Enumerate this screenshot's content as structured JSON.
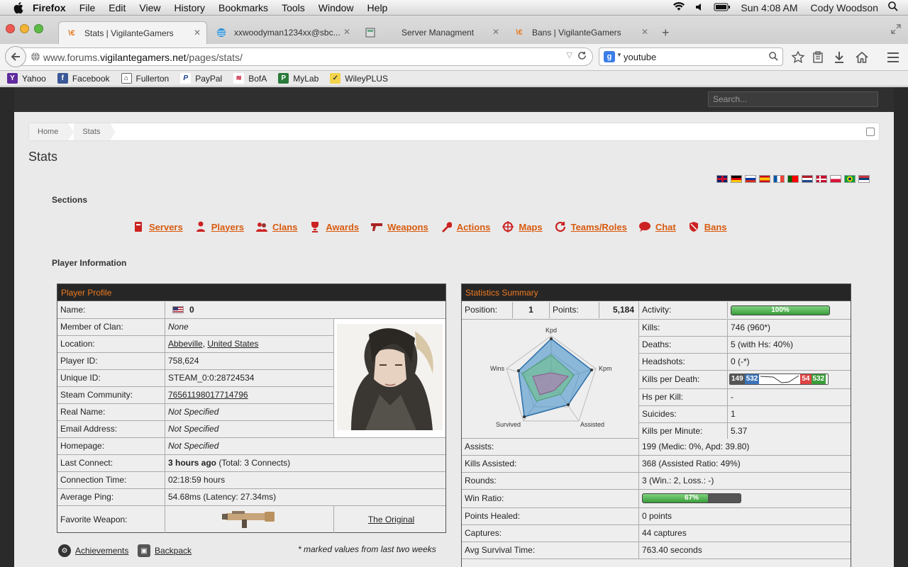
{
  "menubar": {
    "app": "Firefox",
    "items": [
      "File",
      "Edit",
      "View",
      "History",
      "Bookmarks",
      "Tools",
      "Window",
      "Help"
    ],
    "clock": "Sun 4:08 AM",
    "user": "Cody Woodson"
  },
  "tabs": [
    {
      "label": "Stats | VigilanteGamers",
      "icon": "vg-icon"
    },
    {
      "label": "xxwoodyman1234xx@sbc...",
      "icon": "att-icon"
    },
    {
      "label": "Server Managment",
      "icon": "server-icon"
    },
    {
      "label": "Bans | VigilanteGamers",
      "icon": "vg-icon"
    }
  ],
  "tab_close": "✕",
  "new_tab": "+",
  "nav": {
    "url_prefix": "www.forums.",
    "url_domain": "vigilantegamers.net",
    "url_path": "/pages/stats/",
    "search_value": "youtube"
  },
  "bookmarks": [
    "Yahoo",
    "Facebook",
    "Fullerton",
    "PayPal",
    "BofA",
    "MyLab",
    "WileyPLUS"
  ],
  "site": {
    "search_placeholder": "Search...",
    "breadcrumb": [
      "Home",
      "Stats"
    ],
    "page_title": "Stats",
    "sections_title": "Sections",
    "sections": [
      "Servers",
      "Players",
      "Clans",
      "Awards",
      "Weapons",
      "Actions",
      "Maps",
      "Teams/Roles",
      "Chat",
      "Bans"
    ],
    "player_info_title": "Player Information"
  },
  "profile": {
    "header": "Player Profile",
    "rows": [
      {
        "label": "Name:",
        "value": "0"
      },
      {
        "label": "Member of Clan:",
        "value": "None"
      },
      {
        "label": "Location:",
        "value": "Abbeville",
        "value2": "United States"
      },
      {
        "label": "Player ID:",
        "value": "758,624"
      },
      {
        "label": "Unique ID:",
        "value": "STEAM_0:0:28724534"
      },
      {
        "label": "Steam Community:",
        "value": "76561198017714796"
      },
      {
        "label": "Real Name:",
        "value": "Not Specified"
      },
      {
        "label": "Email Address:",
        "value": "Not Specified"
      },
      {
        "label": "Homepage:",
        "value": "Not Specified"
      },
      {
        "label": "Last Connect:",
        "value": "3 hours ago",
        "value2": "(Total: 3 Connects)"
      },
      {
        "label": "Connection Time:",
        "value": "02:18:59 hours"
      },
      {
        "label": "Average Ping:",
        "value": "54.68ms (Latency: 27.34ms)"
      },
      {
        "label": "Favorite Weapon:",
        "value": "The Original"
      }
    ],
    "achievements": "Achievements",
    "backpack": "Backpack",
    "footnote": "* marked values from last two weeks"
  },
  "summary": {
    "header": "Statistics Summary",
    "position_label": "Position:",
    "position": "1",
    "points_label": "Points:",
    "points": "5,184",
    "activity_label": "Activity:",
    "activity": "100%",
    "activity_frac": 1.0,
    "radar_labels": [
      "Kpd",
      "Kpm",
      "Assisted",
      "Survived",
      "Wins"
    ],
    "right_rows": [
      {
        "label": "Kills:",
        "value": "746 (960*)"
      },
      {
        "label": "Deaths:",
        "value": "5 (with Hs: 40%)"
      },
      {
        "label": "Headshots:",
        "value": "0 (-*)"
      },
      {
        "label": "Kills per Death:",
        "value": ""
      },
      {
        "label": "Hs per Kill:",
        "value": "-"
      },
      {
        "label": "Suicides:",
        "value": "1"
      },
      {
        "label": "Kills per Minute:",
        "value": "5.37"
      }
    ],
    "kpd_badges": [
      "149",
      "532",
      "54",
      "532"
    ],
    "full_rows": [
      {
        "label": "Assists:",
        "value": "199 (Medic: 0%, Apd: 39.80)"
      },
      {
        "label": "Kills Assisted:",
        "value": "368 (Assisted Ratio: 49%)"
      },
      {
        "label": "Rounds:",
        "value": "3 (Win.: 2, Loss.: -)"
      },
      {
        "label": "Win Ratio:",
        "value": ""
      },
      {
        "label": "Points Healed:",
        "value": "0 points"
      },
      {
        "label": "Captures:",
        "value": "44 captures"
      },
      {
        "label": "Avg Survival Time:",
        "value": "763.40 seconds"
      }
    ],
    "win_ratio": "67%",
    "win_ratio_frac": 0.67
  }
}
